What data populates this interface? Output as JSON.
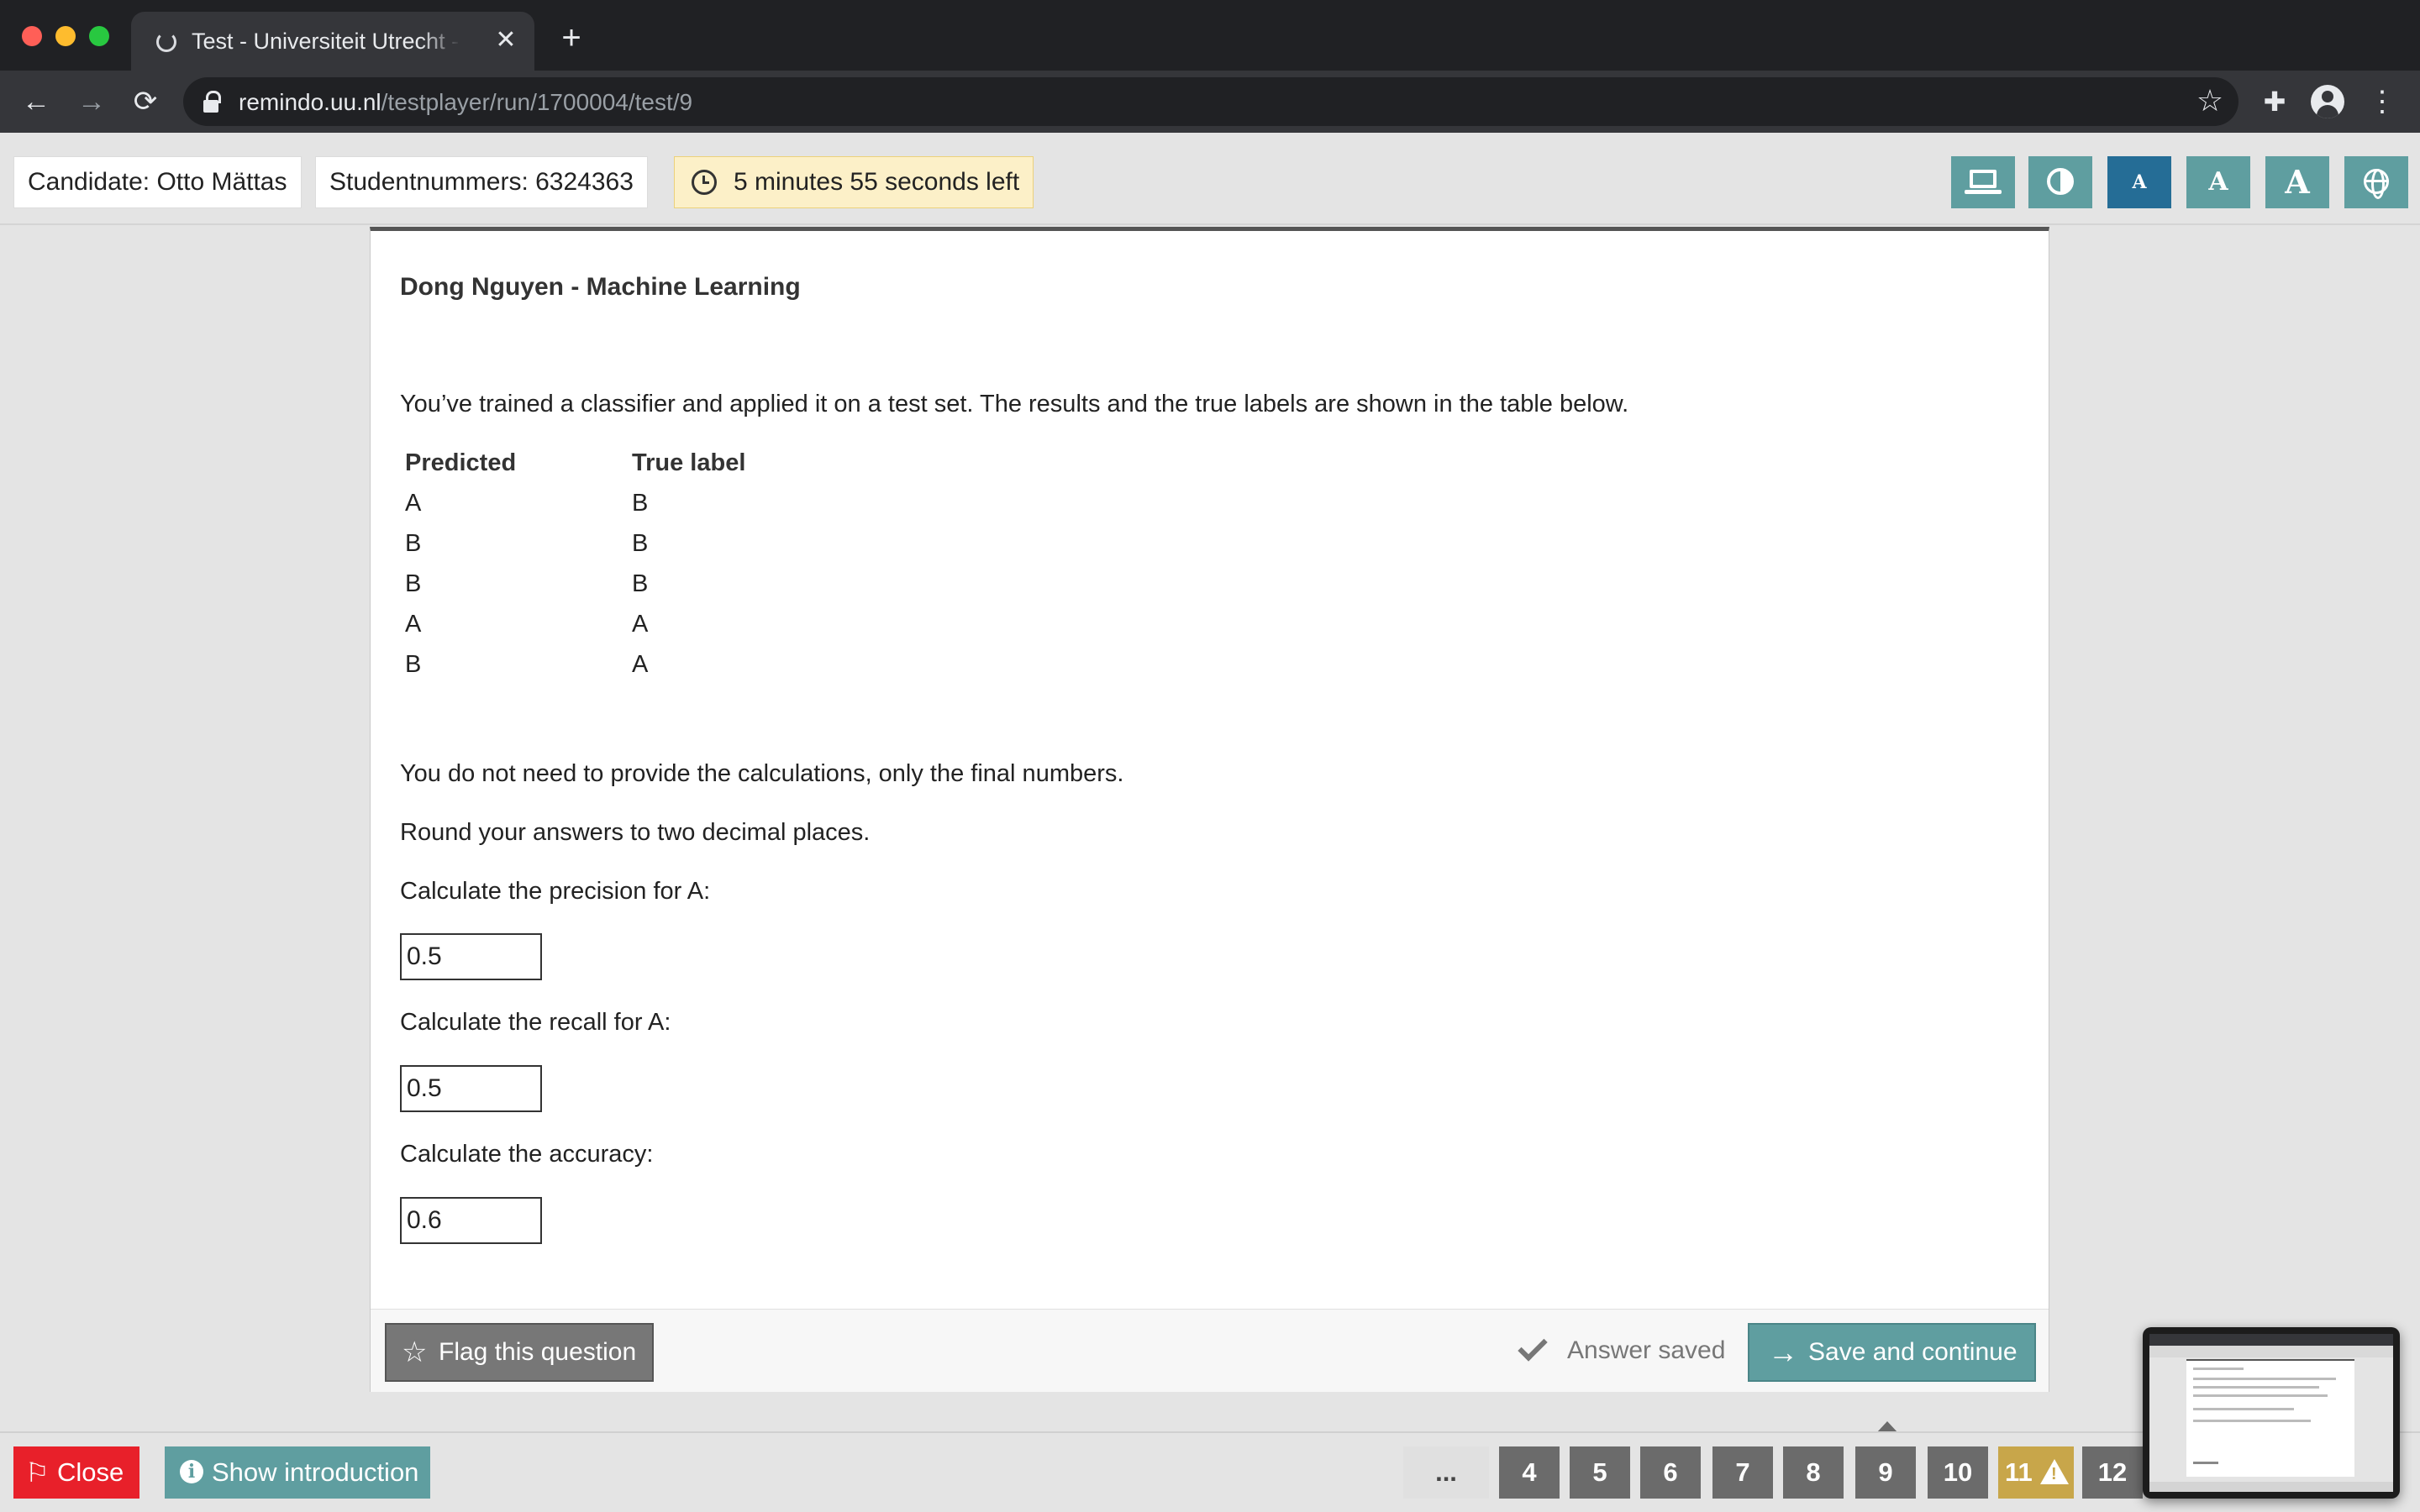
{
  "browser": {
    "tab_title": "Test - Universiteit Utrecht - Remindo",
    "tab_close": "✕",
    "new_tab": "+",
    "url_host": "remindo.uu.nl",
    "url_path": "/testplayer/run/1700004/test/9",
    "icons": [
      "back-arrow-icon",
      "forward-arrow-icon",
      "reload-icon",
      "lock-icon",
      "bookmark-star-icon",
      "extensions-icon",
      "profile-icon",
      "menu-icon"
    ]
  },
  "header": {
    "candidate": "Candidate: Otto Mättas",
    "student_number": "Studentnummers: 6324363",
    "timer": "5 minutes 55 seconds left",
    "font_small": "A",
    "font_medium": "A",
    "font_large": "A"
  },
  "question": {
    "title": "Dong Nguyen - Machine Learning",
    "intro": "You’ve trained a classifier and applied it on a test set. The results and the true labels are shown in the table below.",
    "table": {
      "headers": [
        "Predicted",
        "True label"
      ],
      "rows": [
        [
          "A",
          "B"
        ],
        [
          "B",
          "B"
        ],
        [
          "B",
          "B"
        ],
        [
          "A",
          "A"
        ],
        [
          "B",
          "A"
        ]
      ]
    },
    "note_1": "You do not need to provide the calculations, only the final numbers.",
    "note_2": "Round your answers to two decimal places.",
    "precision_label": "Calculate the precision for A:",
    "precision_value": "0.5",
    "recall_label": "Calculate the recall for A:",
    "recall_value": "0.5",
    "accuracy_label": "Calculate the accuracy:",
    "accuracy_value": "0.6"
  },
  "footer": {
    "flag_label": "Flag this question",
    "saved_label": "Answer saved",
    "save_label": "Save and continue"
  },
  "bottom": {
    "close_label": "Close",
    "intro_label": "Show introduction",
    "info_glyph": "i",
    "nav_more": "...",
    "nav_numbers": [
      "4",
      "5",
      "6",
      "7",
      "8",
      "9",
      "10",
      "11",
      "12"
    ],
    "current_question": "9",
    "flagged_question": "11"
  },
  "colors": {
    "accent": "#5f9ea0",
    "font_selected": "#256d96",
    "timer_bg": "#fcf0c8",
    "close_red": "#e8202a",
    "warning": "#c8a64a"
  }
}
